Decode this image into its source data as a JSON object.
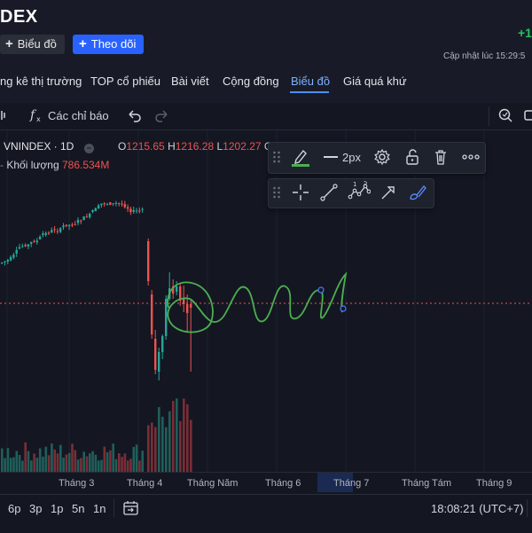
{
  "header": {
    "title": "DEX",
    "change_text": "+1",
    "chart_button_label": "Biểu đồ",
    "follow_button_label": "Theo dõi",
    "updated_text": "Cập nhật lúc  15:29:5"
  },
  "nav": {
    "items": [
      {
        "label": "ng kê thị trường"
      },
      {
        "label": "TOP cổ phiếu"
      },
      {
        "label": "Bài viết"
      },
      {
        "label": "Cộng đồng"
      },
      {
        "label": "Biểu đồ",
        "active": true
      },
      {
        "label": "Giá quá khứ"
      }
    ]
  },
  "toolbar": {
    "indicators_label": "Các chỉ báo"
  },
  "legend": {
    "symbol": "VNINDEX · 1D",
    "open_label": "O",
    "open_value": "1215.65",
    "high_label": "H",
    "high_value": "1216.28",
    "low_label": "L",
    "low_value": "1202.27",
    "close_label": "C",
    "volume_label": "Khối lượng",
    "volume_value": "786.534M"
  },
  "drawing_toolbar": {
    "line_width_label": "2px",
    "brush_color": "#4caf50",
    "icons": [
      "drag-handle-icon",
      "pencil-icon",
      "line-width-icon",
      "settings-icon",
      "unlock-icon",
      "trash-icon",
      "more-icon"
    ],
    "tools_row2": [
      "drag-handle-icon",
      "crosshair-icon",
      "trend-line-icon",
      "elliott-wave-icon",
      "arrow-icon",
      "brush-icon"
    ],
    "elliott_labels": [
      "1",
      "5"
    ]
  },
  "time_axis": {
    "labels": [
      "Tháng 3",
      "Tháng 4",
      "Tháng Năm",
      "Tháng 6",
      "Tháng 7",
      "Tháng Tám",
      "Tháng 9"
    ],
    "highlighted": "Tháng 7"
  },
  "bottom_bar": {
    "ranges": [
      "6p",
      "3p",
      "1p",
      "5n",
      "1n"
    ],
    "clock": "18:08:21 (UTC+7)"
  },
  "colors": {
    "up": "#26a69a",
    "down": "#ef5350",
    "accent": "#2962ff",
    "drawing": "#4caf50",
    "price_line": "#ef5350"
  }
}
